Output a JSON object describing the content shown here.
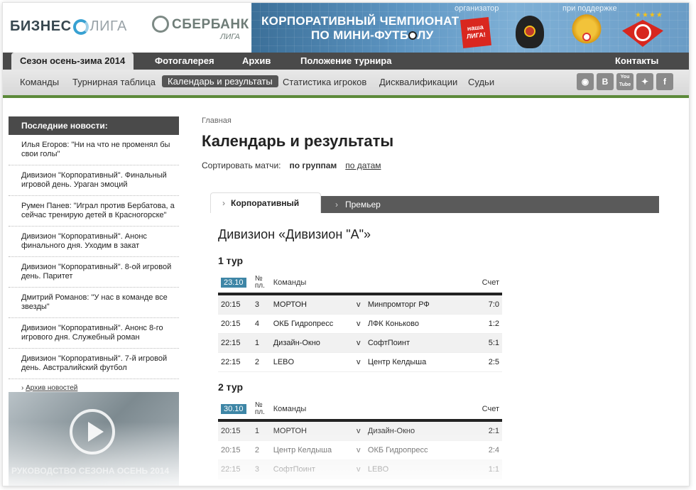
{
  "header": {
    "logo_text1": "БИЗНЕС",
    "logo_text2": "ЛИГА",
    "sponsor_name": "СБЕРБАНК",
    "sponsor_sub": "ЛИГА",
    "banner_line1": "КОРПОРАТИВНЫЙ ЧЕМПИОНАТ",
    "banner_line2a": "ПО МИНИ-ФУТБ",
    "banner_line2b": "ЛУ",
    "organizer_label": "организатор",
    "support_label": "при поддержке",
    "nasha_liga_text": "наша ЛИГА!",
    "stars": "★★★★",
    "accent_color": "#3e86a6",
    "green_stripe": "#5c8a3a"
  },
  "main_nav": {
    "season": "Сезон осень-зима 2014",
    "photo": "Фотогалерея",
    "archive": "Архив",
    "standings": "Положение турнира",
    "contacts": "Контакты"
  },
  "sub_nav": {
    "teams": "Команды",
    "table": "Турнирная таблица",
    "calendar": "Календарь и результаты",
    "stats": "Статистика игроков",
    "disq": "Дисквалификации",
    "referees": "Судьи"
  },
  "social": {
    "instagram": "instagram-icon",
    "vk": "В",
    "youtube": "You Tube",
    "twitter": "twitter-icon",
    "facebook": "f"
  },
  "sidebar": {
    "title": "Последние новости:",
    "news": [
      "Илья Егоров: \"Ни на что не променял бы свои голы\"",
      "Дивизион \"Корпоративный\". Финальный игровой день. Ураган эмоций",
      "Румен Панев: \"Играл против Бербатова, а сейчас тренирую детей в Красногорске\"",
      "Дивизион \"Корпоративный\". Анонс финального дня. Уходим в закат",
      "Дивизион \"Корпоративный\". 8-ой игровой день. Паритет",
      "Дмитрий Романов: \"У нас в команде все звезды\"",
      "Дивизион \"Корпоративный\". Анонс 8-го игрового дня. Служебный роман",
      "Дивизион \"Корпоративный\". 7-й игровой день. Австралийский футбол"
    ],
    "archive_link": "Архив новостей",
    "video_caption": "РУКОВОДСТВО СЕЗОНА ОСЕНЬ 2014"
  },
  "content": {
    "breadcrumb": "Главная",
    "title": "Календарь и результаты",
    "sort_label": "Сортировать матчи:",
    "sort_groups": "по группам",
    "sort_dates": "по датам",
    "tab_corporate": "Корпоративный",
    "tab_premier": "Премьер",
    "division": "Дивизион «Дивизион \"А\"»",
    "columns": {
      "num": "№ пл.",
      "teams": "Команды",
      "score": "Счет"
    },
    "rounds": [
      {
        "label": "1 тур",
        "date": "23.10",
        "matches": [
          {
            "time": "20:15",
            "num": "3",
            "home": "МОРТОН",
            "v": "v",
            "away": "Минпромторг РФ",
            "score": "7:0"
          },
          {
            "time": "20:15",
            "num": "4",
            "home": "ОКБ Гидропресс",
            "v": "v",
            "away": "ЛФК Коньково",
            "score": "1:2"
          },
          {
            "time": "22:15",
            "num": "1",
            "home": "Дизайн-Окно",
            "v": "v",
            "away": "СофтПоинт",
            "score": "5:1"
          },
          {
            "time": "22:15",
            "num": "2",
            "home": "LEBO",
            "v": "v",
            "away": "Центр Келдыша",
            "score": "2:5"
          }
        ]
      },
      {
        "label": "2 тур",
        "date": "30.10",
        "matches": [
          {
            "time": "20:15",
            "num": "1",
            "home": "МОРТОН",
            "v": "v",
            "away": "Дизайн-Окно",
            "score": "2:1"
          },
          {
            "time": "20:15",
            "num": "2",
            "home": "Центр Келдыша",
            "v": "v",
            "away": "ОКБ Гидропресс",
            "score": "2:4"
          },
          {
            "time": "22:15",
            "num": "3",
            "home": "СофтПоинт",
            "v": "v",
            "away": "LEBO",
            "score": "1:1"
          }
        ]
      }
    ]
  }
}
